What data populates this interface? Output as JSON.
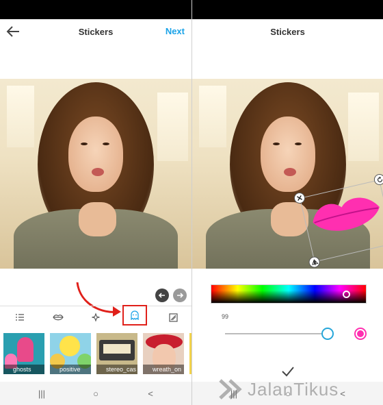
{
  "left_screen": {
    "header": {
      "title": "Stickers",
      "next_label": "Next"
    },
    "photo_nav": {
      "prev_icon": "arrow-left-icon",
      "next_icon": "arrow-right-icon"
    },
    "category_tabs": [
      {
        "icon": "list-icon",
        "active": false
      },
      {
        "icon": "lips-icon",
        "active": false
      },
      {
        "icon": "sparkle-icon",
        "active": false
      },
      {
        "icon": "ghost-icon",
        "active": true
      },
      {
        "icon": "image-icon",
        "active": false
      }
    ],
    "stickers": [
      {
        "label": "ghosts"
      },
      {
        "label": "positive"
      },
      {
        "label": "stereo_cas"
      },
      {
        "label": "wreath_on"
      }
    ],
    "annotation_color": "#e0201a"
  },
  "right_screen": {
    "header": {
      "title": "Stickers"
    },
    "sticker": {
      "name": "kiss-lips",
      "color": "#ff2fb0"
    },
    "opacity_value": "99",
    "opacity_fraction": 0.99,
    "selected_color": "#ff2fb0",
    "confirm_icon": "check-icon"
  },
  "system_nav": {
    "recents": "|||",
    "home": "○",
    "back": "<"
  },
  "watermark": {
    "text": "JalanTikus"
  }
}
